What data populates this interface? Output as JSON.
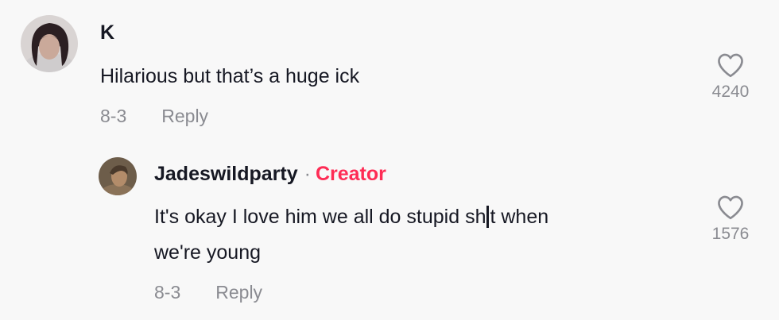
{
  "comment": {
    "username": "K",
    "text": "Hilarious but that’s a huge ick",
    "date": "8-3",
    "reply_label": "Reply",
    "like_count": "4240"
  },
  "reply": {
    "username": "Jadeswildparty",
    "separator": "·",
    "badge": "Creator",
    "text_part1": "It's okay I love him we all do stupid sh",
    "text_part2": "t when",
    "text_line2": "we're young",
    "date": "8-3",
    "reply_label": "Reply",
    "like_count": "1576"
  },
  "colors": {
    "background": "#f8f8f8",
    "creator_badge": "#fe2c55",
    "muted": "#8a8b91",
    "text": "#161823"
  },
  "icons": {
    "like": "heart-outline-icon"
  }
}
